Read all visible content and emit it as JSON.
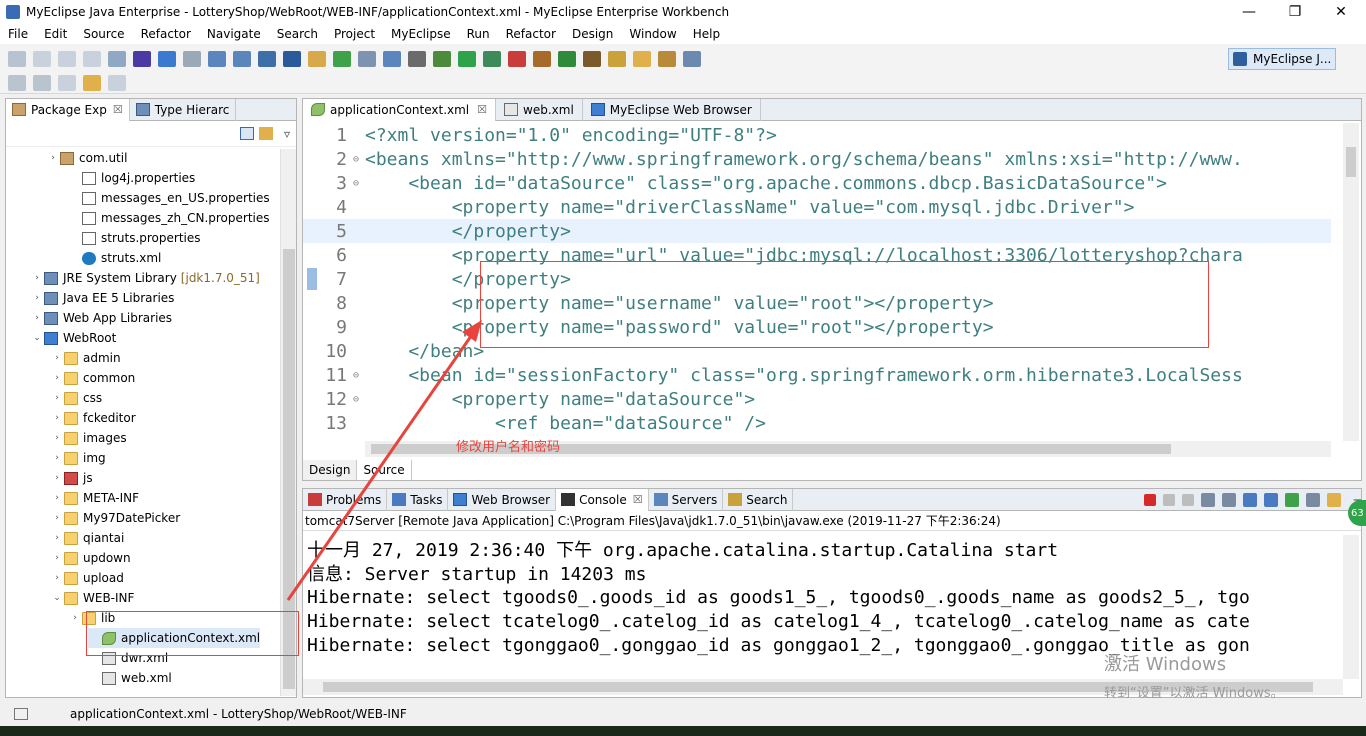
{
  "window": {
    "title": "MyEclipse Java Enterprise - LotteryShop/WebRoot/WEB-INF/applicationContext.xml - MyEclipse Enterprise Workbench"
  },
  "menu": [
    "File",
    "Edit",
    "Source",
    "Refactor",
    "Navigate",
    "Search",
    "Project",
    "MyEclipse",
    "Run",
    "Refactor",
    "Design",
    "Window",
    "Help"
  ],
  "perspective": "MyEclipse J...",
  "left_panel": {
    "tabs": [
      {
        "label": "Package Exp",
        "close": "☒"
      },
      {
        "label": "Type Hierarc"
      }
    ],
    "tree": [
      {
        "label": "com.util",
        "icon": "package-icon"
      },
      {
        "label": "log4j.properties",
        "icon": "file-icon"
      },
      {
        "label": "messages_en_US.properties",
        "icon": "file-icon"
      },
      {
        "label": "messages_zh_CN.properties",
        "icon": "file-icon"
      },
      {
        "label": "struts.properties",
        "icon": "file-icon"
      },
      {
        "label": "struts.xml",
        "icon": "gear-icon"
      },
      {
        "label": "JRE System Library",
        "extra": "[jdk1.7.0_51]",
        "icon": "library-icon"
      },
      {
        "label": "Java EE 5 Libraries",
        "icon": "library-icon"
      },
      {
        "label": "Web App Libraries",
        "icon": "library-icon"
      },
      {
        "label": "WebRoot",
        "icon": "webroot-icon"
      },
      {
        "label": "admin",
        "icon": "folder-icon"
      },
      {
        "label": "common",
        "icon": "folder-icon"
      },
      {
        "label": "css",
        "icon": "folder-icon"
      },
      {
        "label": "fckeditor",
        "icon": "folder-icon"
      },
      {
        "label": "images",
        "icon": "folder-icon"
      },
      {
        "label": "img",
        "icon": "folder-icon"
      },
      {
        "label": "js",
        "icon": "js-folder-icon"
      },
      {
        "label": "META-INF",
        "icon": "folder-icon"
      },
      {
        "label": "My97DatePicker",
        "icon": "folder-icon"
      },
      {
        "label": "qiantai",
        "icon": "folder-icon"
      },
      {
        "label": "updown",
        "icon": "folder-icon"
      },
      {
        "label": "upload",
        "icon": "folder-icon"
      },
      {
        "label": "WEB-INF",
        "icon": "folder-icon"
      },
      {
        "label": "lib",
        "icon": "folder-icon"
      },
      {
        "label": "applicationContext.xml",
        "icon": "spring-leaf-icon"
      },
      {
        "label": "dwr.xml",
        "icon": "xml-icon"
      },
      {
        "label": "web.xml",
        "icon": "xml-icon"
      }
    ]
  },
  "editor": {
    "tabs": [
      {
        "label": "applicationContext.xml",
        "close": "☒"
      },
      {
        "label": "web.xml"
      },
      {
        "label": "MyEclipse Web Browser"
      }
    ],
    "line_numbers": [
      "1",
      "2",
      "3",
      "4",
      "5",
      "6",
      "7",
      "8",
      "9",
      "10",
      "11",
      "12",
      "13"
    ],
    "lines": [
      "<?xml version=\"1.0\" encoding=\"UTF-8\"?>",
      "<beans xmlns=\"http://www.springframework.org/schema/beans\" xmlns:xsi=\"http://www.",
      "    <bean id=\"dataSource\" class=\"org.apache.commons.dbcp.BasicDataSource\">",
      "        <property name=\"driverClassName\" value=\"com.mysql.jdbc.Driver\">",
      "        </property>",
      "        <property name=\"url\" value=\"jdbc:mysql://localhost:3306/lotteryshop?chara",
      "        </property>",
      "        <property name=\"username\" value=\"root\"></property>",
      "        <property name=\"password\" value=\"root\"></property>",
      "    </bean>",
      "    <bean id=\"sessionFactory\" class=\"org.springframework.orm.hibernate3.LocalSess",
      "        <property name=\"dataSource\">",
      "            <ref bean=\"dataSource\" />"
    ],
    "bottom_tabs": [
      "Design",
      "Source"
    ]
  },
  "console": {
    "tabs": [
      "Problems",
      "Tasks",
      "Web Browser",
      "Console",
      "Servers",
      "Search"
    ],
    "description": "tomcat7Server [Remote Java Application] C:\\Program Files\\Java\\jdk1.7.0_51\\bin\\javaw.exe (2019-11-27 下午2:36:24)",
    "lines": [
      "十一月 27, 2019 2:36:40 下午 org.apache.catalina.startup.Catalina start",
      "信息: Server startup in 14203 ms",
      "Hibernate: select tgoods0_.goods_id as goods1_5_, tgoods0_.goods_name as goods2_5_, tgo",
      "Hibernate: select tcatelog0_.catelog_id as catelog1_4_, tcatelog0_.catelog_name as cate",
      "Hibernate: select tgonggao0_.gonggao_id as gonggao1_2_, tgonggao0_.gonggao_title as gon"
    ]
  },
  "annotation": {
    "text": "修改用户名和密码"
  },
  "watermark": {
    "line1": "激活 Windows",
    "line2": "转到“设置”以激活 Windows。"
  },
  "badge": "63",
  "status": {
    "text": "applicationContext.xml - LotteryShop/WebRoot/WEB-INF"
  },
  "colors": {
    "tag": "#3f7f7f",
    "attr": "#7f007f",
    "value": "#2a00ff",
    "annotation": "#e8443d"
  }
}
